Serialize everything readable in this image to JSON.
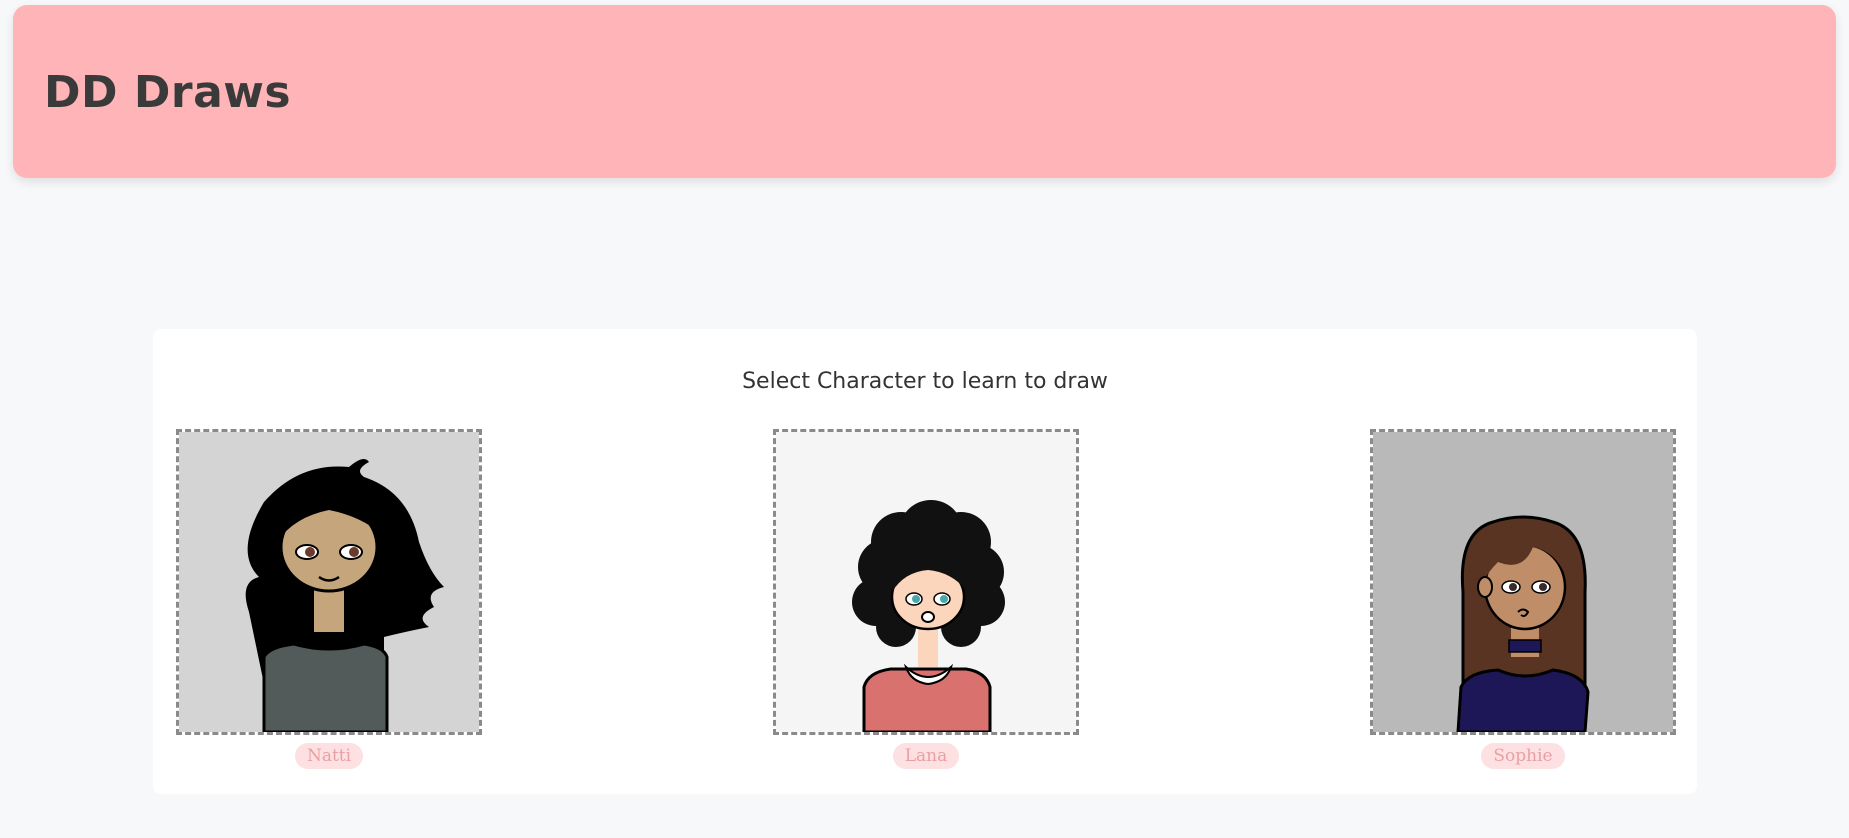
{
  "header": {
    "title": "DD Draws",
    "color": "#ffb5b8"
  },
  "main": {
    "prompt": "Select Character to learn to draw",
    "characters": [
      {
        "name": "Natti",
        "background": "#d4d4d4",
        "hair": "#000000",
        "skin": "#c4a57c",
        "shirt": "#535a5a"
      },
      {
        "name": "Lana",
        "background": "#f5f5f5",
        "hair": "#111111",
        "skin": "#fcd5bd",
        "shirt": "#d9726f"
      },
      {
        "name": "Sophie",
        "background": "#b9b9b9",
        "hair": "#5a3423",
        "skin": "#bf8e68",
        "shirt": "#1e1757"
      }
    ],
    "label_color": "#e9a0a4"
  }
}
